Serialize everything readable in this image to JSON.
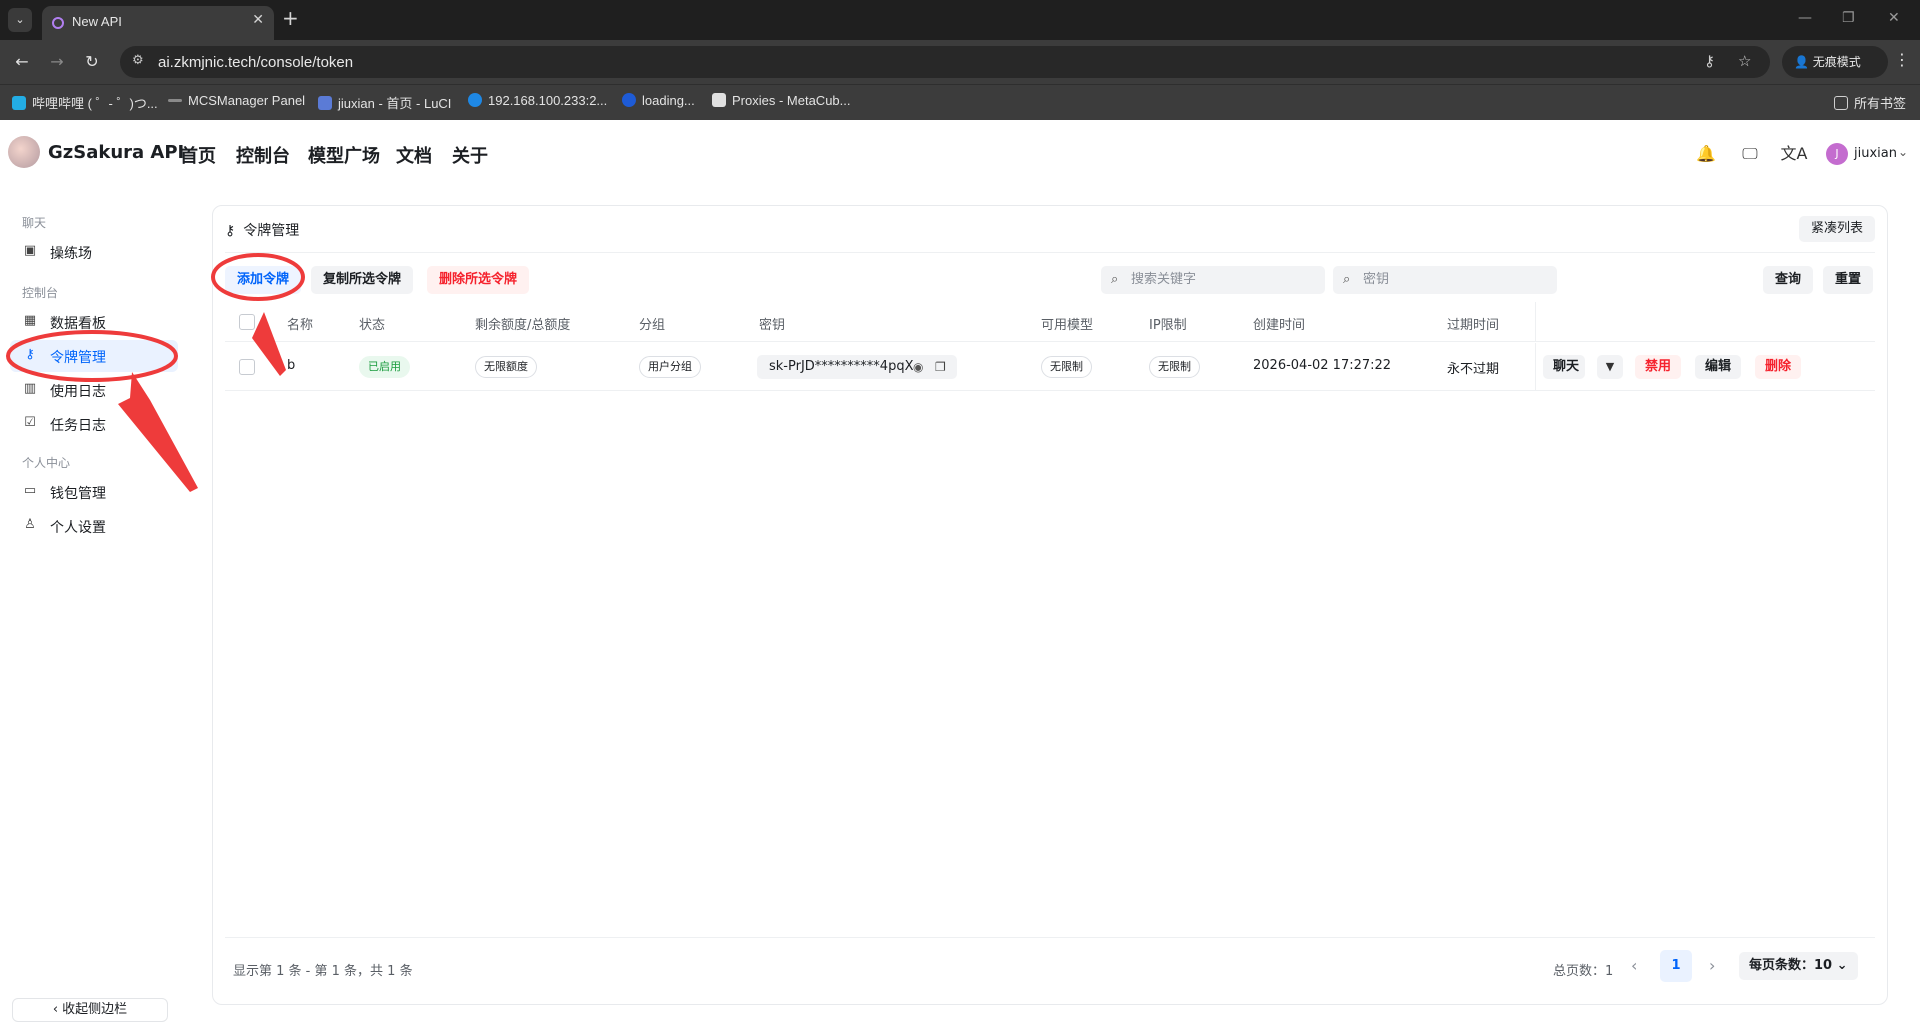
{
  "browser": {
    "tab_title": "New API",
    "url": "ai.zkmjnic.tech/console/token",
    "incognito_label": "无痕模式",
    "bookmarks": [
      {
        "label": "哔哩哔哩 ( ゜- ゜)つ...",
        "color": "#23ade5"
      },
      {
        "label": "MCSManager Panel",
        "color": "#8a8a8a"
      },
      {
        "label": "jiuxian - 首页 - LuCI",
        "color": "#5b7bd6"
      },
      {
        "label": "192.168.100.233:2...",
        "color": "#1e88e5"
      },
      {
        "label": "loading...",
        "color": "#1e5bd6"
      },
      {
        "label": "Proxies - MetaCub...",
        "color": "#e0e0e0"
      }
    ],
    "all_bookmarks_label": "所有书签"
  },
  "header": {
    "brand": "GzSakura API",
    "nav": [
      "首页",
      "控制台",
      "模型广场",
      "文档",
      "关于"
    ],
    "user": {
      "initial": "J",
      "name": "jiuxian"
    }
  },
  "sidebar": {
    "sections": [
      {
        "title": "聊天",
        "items": [
          {
            "label": "操练场",
            "icon": "terminal-icon"
          }
        ]
      },
      {
        "title": "控制台",
        "items": [
          {
            "label": "数据看板",
            "icon": "dashboard-icon"
          },
          {
            "label": "令牌管理",
            "icon": "key-icon",
            "active": true
          },
          {
            "label": "使用日志",
            "icon": "bar-chart-icon"
          },
          {
            "label": "任务日志",
            "icon": "checklist-icon"
          }
        ]
      },
      {
        "title": "个人中心",
        "items": [
          {
            "label": "钱包管理",
            "icon": "wallet-icon"
          },
          {
            "label": "个人设置",
            "icon": "user-icon"
          }
        ]
      }
    ],
    "collapse_label": "收起侧边栏"
  },
  "main": {
    "title": "令牌管理",
    "compact_label": "紧凑列表",
    "buttons": {
      "add": "添加令牌",
      "copy": "复制所选令牌",
      "delete": "删除所选令牌",
      "query": "查询",
      "reset": "重置"
    },
    "search_placeholder": "搜索关键字",
    "key_placeholder": "密钥",
    "columns": [
      "名称",
      "状态",
      "剩余额度/总额度",
      "分组",
      "密钥",
      "可用模型",
      "IP限制",
      "创建时间",
      "过期时间"
    ],
    "rows": [
      {
        "name": "b",
        "status": "已启用",
        "quota": "无限额度",
        "group": "用户分组",
        "key": "sk-PrJD**********4pqX",
        "models": "无限制",
        "ip_limit": "无限制",
        "created": "2026-04-02 17:27:22",
        "expires": "永不过期",
        "actions": {
          "chat": "聊天",
          "disable": "禁用",
          "edit": "编辑",
          "delete": "删除"
        }
      }
    ],
    "pagination": {
      "info": "显示第 1 条 - 第 1 条，共 1 条",
      "total_pages": "总页数：1",
      "current_page": "1",
      "page_size": "每页条数：10"
    }
  },
  "colors": {
    "accent": "#0064fa",
    "danger": "#f5222d",
    "success": "#1a9c3e",
    "annotation": "#ee3b3b"
  }
}
